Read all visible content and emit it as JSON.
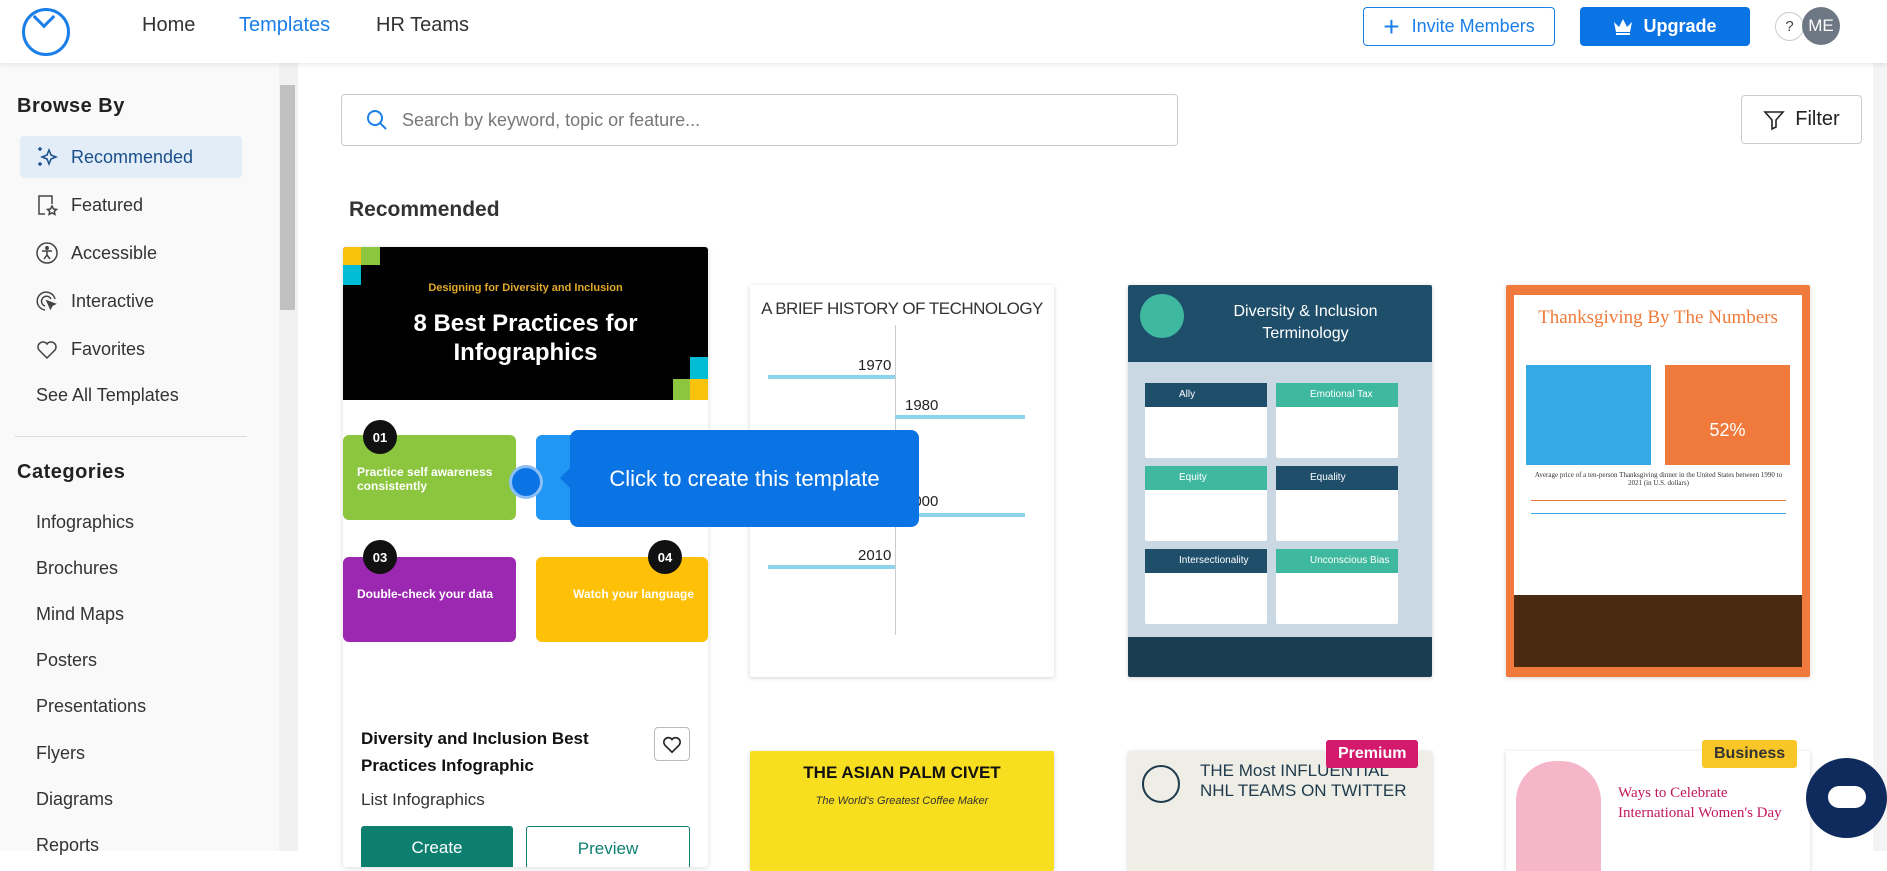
{
  "header": {
    "nav": [
      "Home",
      "Templates",
      "HR Teams"
    ],
    "active_nav": "Templates",
    "invite_label": "Invite Members",
    "upgrade_label": "Upgrade",
    "help_label": "?",
    "avatar_initials": "ME"
  },
  "sidebar": {
    "browse_title": "Browse By",
    "browse_items": [
      {
        "label": "Recommended",
        "icon": "sparkles-icon",
        "active": true
      },
      {
        "label": "Featured",
        "icon": "featured-star-icon"
      },
      {
        "label": "Accessible",
        "icon": "accessibility-icon"
      },
      {
        "label": "Interactive",
        "icon": "pointer-click-icon"
      },
      {
        "label": "Favorites",
        "icon": "heart-icon"
      }
    ],
    "see_all": "See All Templates",
    "categories_title": "Categories",
    "categories": [
      "Infographics",
      "Brochures",
      "Mind Maps",
      "Posters",
      "Presentations",
      "Flyers",
      "Diagrams",
      "Reports"
    ]
  },
  "search": {
    "placeholder": "Search by keyword, topic or feature..."
  },
  "filter_label": "Filter",
  "section_title": "Recommended",
  "featured_card": {
    "thumb_subtitle": "Designing for Diversity and Inclusion",
    "thumb_title": "8 Best Practices for Infographics",
    "tips": [
      {
        "num": "01",
        "text": "Practice self awareness consistently"
      },
      {
        "num": "03",
        "text": "Double-check your data"
      },
      {
        "num": "04",
        "text": "Watch your language"
      }
    ],
    "title": "Diversity and Inclusion Best Practices Infographic",
    "category": "List Infographics",
    "create_label": "Create",
    "preview_label": "Preview"
  },
  "tooltip": "Click to create this template",
  "templates": [
    {
      "title": "A BRIEF HISTORY OF TECHNOLOGY",
      "years": [
        "1970",
        "1980",
        "2000",
        "2010"
      ]
    },
    {
      "title": "Diversity & Inclusion Terminology",
      "terms": [
        "Ally",
        "Emotional Tax",
        "Equity",
        "Equality",
        "Intersectionality",
        "Unconscious Bias"
      ]
    },
    {
      "title": "Thanksgiving By The Numbers",
      "stat": "52%",
      "chart_title": "Average price of a ten-person Thanksgiving dinner in the United States between 1990 to 2021 (in U.S. dollars)"
    },
    {
      "title": "THE ASIAN PALM CIVET",
      "subtitle": "The World's Greatest Coffee Maker"
    },
    {
      "title": "THE Most INFLUENTIAL NHL TEAMS ON TWITTER",
      "badge": "Premium",
      "badge_color": "#d41a6d"
    },
    {
      "title": "Ways to Celebrate International Women's Day",
      "badge": "Business",
      "badge_color": "#f9c627"
    }
  ],
  "colors": {
    "accent": "#0b74e5",
    "create_button": "#0d7f6f"
  }
}
